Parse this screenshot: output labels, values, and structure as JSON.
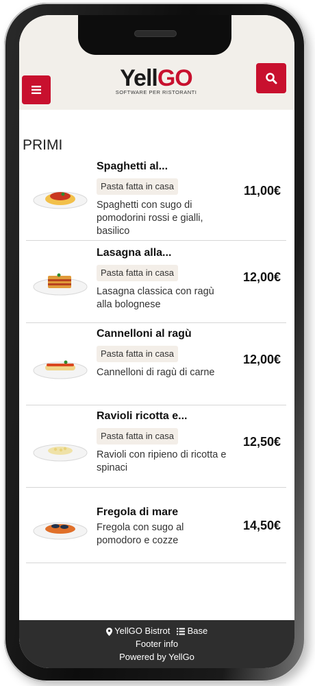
{
  "header": {
    "logo_main_a": "Yell",
    "logo_main_b": "GO",
    "logo_sub": "SOFTWARE PER RISTORANTI"
  },
  "section": {
    "title": "PRIMI"
  },
  "items": [
    {
      "name": "Spaghetti al...",
      "tag": "Pasta fatta in casa",
      "description": "Spaghetti con sugo di pomodorini rossi e gialli, basilico",
      "price": "11,00€"
    },
    {
      "name": "Lasagna alla...",
      "tag": "Pasta fatta in casa",
      "description": "Lasagna classica con ragù alla bolognese",
      "price": "12,00€"
    },
    {
      "name": "Cannelloni al ragù",
      "tag": "Pasta fatta in casa",
      "description": "Cannelloni di ragù di carne",
      "price": "12,00€"
    },
    {
      "name": "Ravioli ricotta e...",
      "tag": "Pasta fatta in casa",
      "description": "Ravioli con ripieno di ricotta e spinaci",
      "price": "12,50€"
    },
    {
      "name": "Fregola di mare",
      "description": "Fregola con sugo al pomodoro e cozze",
      "price": "14,50€"
    }
  ],
  "footer": {
    "location": "YellGO Bistrot",
    "menu": "Base",
    "info": "Footer info",
    "powered": "Powered by YellGo"
  },
  "colors": {
    "accent": "#c8102e",
    "header_bg": "#f2efea",
    "footer_bg": "#2e2e2e",
    "tag_bg": "#f3eee8"
  },
  "icons": [
    "menu-icon",
    "search-icon",
    "map-marker-icon",
    "list-icon"
  ]
}
